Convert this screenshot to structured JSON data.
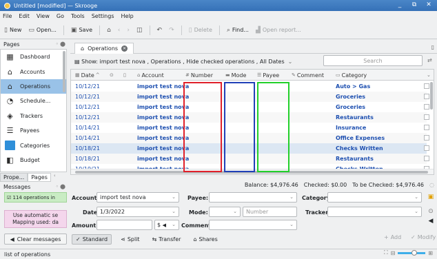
{
  "window": {
    "title": "Untitled [modified] — Skrooge",
    "controls": [
      "_",
      "⧉",
      "✕"
    ]
  },
  "menu": [
    "File",
    "Edit",
    "View",
    "Go",
    "Tools",
    "Settings",
    "Help"
  ],
  "toolbar": {
    "new": "New",
    "open": "Open...",
    "save": "Save",
    "delete": "Delete",
    "find": "Find...",
    "open_report": "Open report..."
  },
  "dock": {
    "title": "Pages",
    "items": [
      {
        "label": "Dashboard",
        "icon": "dashboard-icon"
      },
      {
        "label": "Accounts",
        "icon": "bank-icon"
      },
      {
        "label": "Operations",
        "icon": "operations-icon",
        "selected": true
      },
      {
        "label": "Schedule...",
        "icon": "clock-icon"
      },
      {
        "label": "Trackers",
        "icon": "tracker-icon"
      },
      {
        "label": "Payees",
        "icon": "payees-icon"
      },
      {
        "label": "Categories",
        "icon": "folder-icon"
      },
      {
        "label": "Budget",
        "icon": "budget-icon"
      }
    ],
    "tabs": [
      "Prope...",
      "Pages"
    ]
  },
  "messages": {
    "title": "Messages",
    "items": [
      "114 operations in",
      "Use automatic se",
      "Mapping used: da"
    ],
    "clear": "Clear messages"
  },
  "status": "list of operations",
  "tab": {
    "label": "Operations"
  },
  "filter": {
    "text": "Show: import test nova , Operations , Hide checked operations , All Dates"
  },
  "search": {
    "placeholder": "Search"
  },
  "table": {
    "columns": [
      "Date",
      "Account",
      "Number",
      "Mode",
      "Payee",
      "Comment",
      "Category"
    ],
    "rows": [
      {
        "date": "10/12/21",
        "account": "import test nova",
        "category": "Auto > Gas"
      },
      {
        "date": "10/12/21",
        "account": "import test nova",
        "category": "Groceries"
      },
      {
        "date": "10/12/21",
        "account": "import test nova",
        "category": "Groceries"
      },
      {
        "date": "10/12/21",
        "account": "import test nova",
        "category": "Restaurants"
      },
      {
        "date": "10/14/21",
        "account": "import test nova",
        "category": "Insurance"
      },
      {
        "date": "10/14/21",
        "account": "import test nova",
        "category": "Office Expenses"
      },
      {
        "date": "10/18/21",
        "account": "import test nova",
        "category": "Checks Written"
      },
      {
        "date": "10/18/21",
        "account": "import test nova",
        "category": "Restaurants"
      },
      {
        "date": "10/19/21",
        "account": "import test nova",
        "category": "Checks Written"
      }
    ]
  },
  "balance": {
    "balance": "Balance: $4,976.46",
    "checked": "Checked: $0.00",
    "to_check": "To be Checked: $4,976.46"
  },
  "form": {
    "account_label": "Account:",
    "account_value": "import test nova",
    "payee_label": "Payee:",
    "category_label": "Category:",
    "date_label": "Date:",
    "date_value": "1/3/2022",
    "mode_label": "Mode:",
    "number_placeholder": "Number",
    "tracker_label": "Tracker:",
    "amount_label": "Amount:",
    "currency": "$",
    "comment_label": "Comment:"
  },
  "modes": [
    "Standard",
    "Split",
    "Transfer",
    "Shares"
  ],
  "actions": {
    "add": "Add",
    "modify": "Modify"
  }
}
